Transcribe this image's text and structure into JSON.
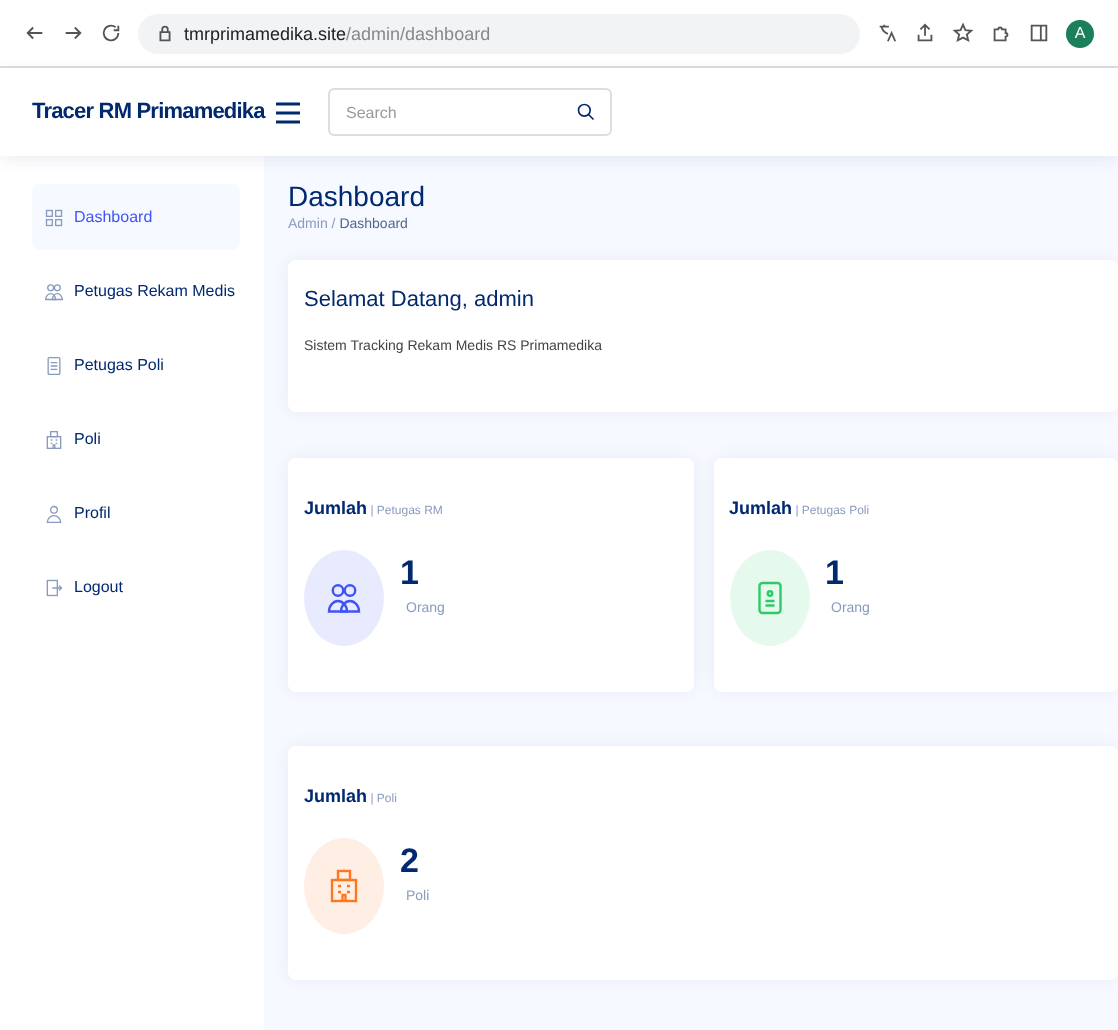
{
  "browser": {
    "url_host": "tmrprimamedika.site",
    "url_path": "/admin/dashboard",
    "profile": "A"
  },
  "header": {
    "brand": "Tracer RM Primamedika",
    "search": {
      "placeholder": "Search"
    }
  },
  "sidebar": {
    "items": [
      {
        "label": "Dashboard",
        "kind": "grid",
        "selected": true
      },
      {
        "label": "Petugas Rekam Medis",
        "kind": "people",
        "selected": false
      },
      {
        "label": "Petugas Poli",
        "kind": "doc",
        "selected": false
      },
      {
        "label": "Poli",
        "kind": "building",
        "selected": false
      },
      {
        "label": "Profil",
        "kind": "person",
        "selected": false
      },
      {
        "label": "Logout",
        "kind": "logout",
        "selected": false
      }
    ]
  },
  "page": {
    "title": "Dashboard",
    "breadcrumb": [
      "Admin",
      "Dashboard"
    ],
    "breadcrumb_separator": "/"
  },
  "welcome": {
    "title": "Selamat Datang, admin",
    "text": "Sistem Tracking Rekam Medis RS Primamedika"
  },
  "stats": [
    {
      "title": "Jumlah",
      "subtitle": "| Petugas RM",
      "value": "1",
      "unit": "Orang",
      "kind": "people",
      "color": "#4154f1"
    },
    {
      "title": "Jumlah",
      "subtitle": "| Petugas Poli",
      "value": "1",
      "unit": "Orang",
      "kind": "phone",
      "color": "#2eca6a"
    },
    {
      "title": "Jumlah",
      "subtitle": "| Poli",
      "value": "2",
      "unit": "Poli",
      "kind": "building",
      "color": "#ff771d"
    }
  ]
}
